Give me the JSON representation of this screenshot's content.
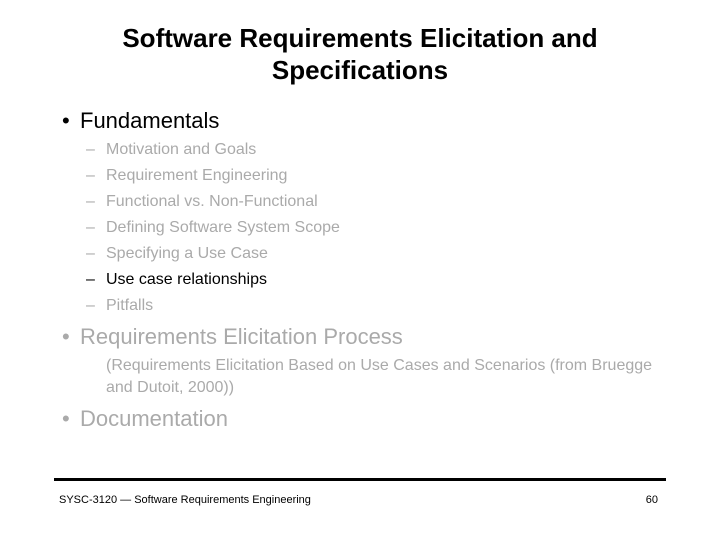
{
  "slide": {
    "title": "Software Requirements Elicitation and Specifications",
    "outline": [
      {
        "label": "Fundamentals",
        "state": "active",
        "subitems": [
          {
            "label": "Motivation and Goals",
            "state": "dim"
          },
          {
            "label": "Requirement Engineering",
            "state": "dim"
          },
          {
            "label": "Functional vs. Non-Functional",
            "state": "dim"
          },
          {
            "label": "Defining Software System Scope",
            "state": "dim"
          },
          {
            "label": "Specifying a Use Case",
            "state": "dim"
          },
          {
            "label": "Use case relationships",
            "state": "active"
          },
          {
            "label": "Pitfalls",
            "state": "dim"
          }
        ]
      },
      {
        "label": "Requirements Elicitation Process",
        "state": "dim",
        "note": "(Requirements Elicitation Based on Use Cases and Scenarios (from Bruegge and Dutoit, 2000))"
      },
      {
        "label": "Documentation",
        "state": "dim"
      }
    ],
    "bullet_glyph": "•",
    "dash_glyph": "–",
    "colors": {
      "active": "#000000",
      "dim": "#aaaaaa"
    }
  },
  "footer": {
    "course": "SYSC-3120 — Software Requirements Engineering",
    "page_number": "60"
  }
}
